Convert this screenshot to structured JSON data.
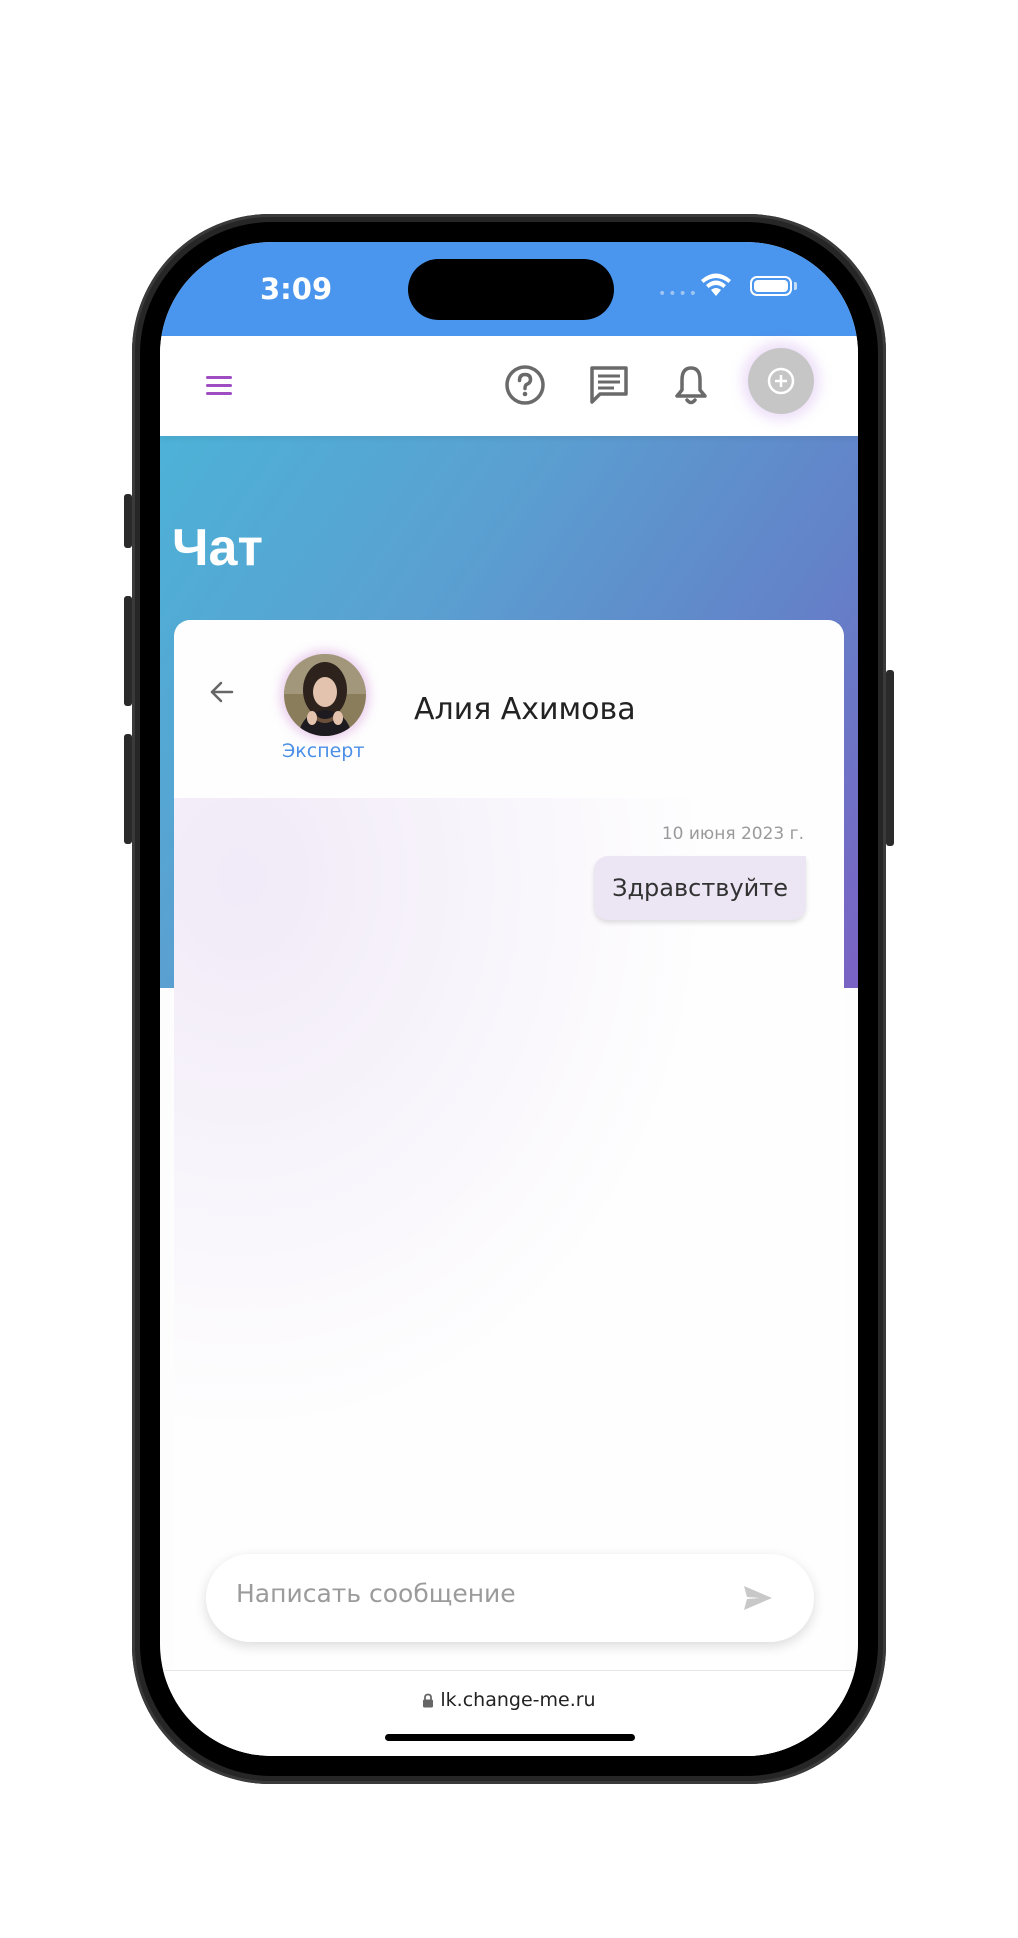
{
  "status_bar": {
    "time": "3:09",
    "signal_dots": "••••"
  },
  "header": {
    "menu_icon": "hamburger-icon",
    "icons": [
      "help-circle-icon",
      "chat-icon",
      "bell-icon",
      "plus-circle-icon"
    ]
  },
  "page": {
    "title": "Чат"
  },
  "chat": {
    "contact_name": "Алия Ахимова",
    "contact_role": "Эксперт",
    "messages": [
      {
        "date": "10 июня 2023 г.",
        "text": "Здравствуйте",
        "direction": "outgoing"
      }
    ]
  },
  "composer": {
    "placeholder": "Написать сообщение",
    "value": ""
  },
  "browser": {
    "url": "lk.change-me.ru"
  },
  "colors": {
    "accent": "#9f4dc3",
    "status_bar": "#4a95ee",
    "link": "#4b8fe6",
    "bubble": "#ece6f4"
  }
}
